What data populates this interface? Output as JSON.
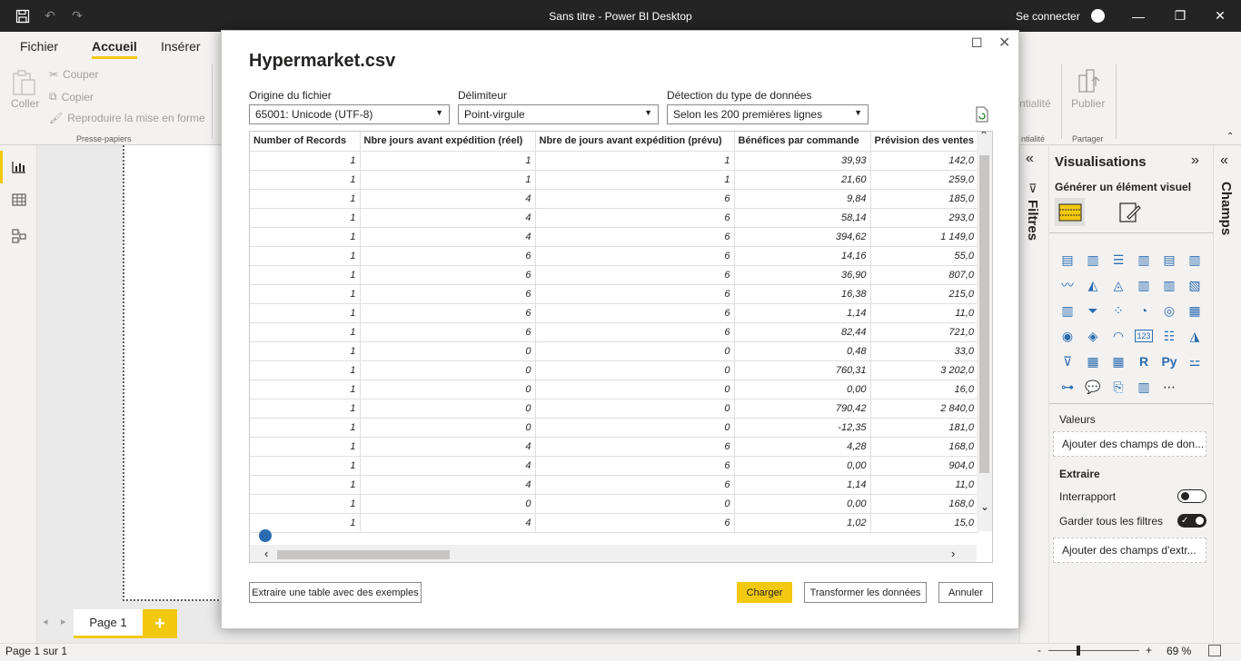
{
  "app": {
    "title": "Sans titre - Power BI Desktop",
    "signin": "Se connecter"
  },
  "ribbon": {
    "tabs": [
      "Fichier",
      "Accueil",
      "Insérer"
    ],
    "clipboard": {
      "paste": "Coller",
      "cut": "Couper",
      "copy": "Copier",
      "format_painter": "Reproduire la mise en forme",
      "group": "Presse-papiers"
    },
    "sensitivity": "ntialité",
    "sensitivity_group": "ntialité",
    "publish": "Publier",
    "share_group": "Partager"
  },
  "page_tab": "Page 1",
  "status": {
    "page_info": "Page 1 sur 1",
    "zoom": "69 %",
    "minus": "-",
    "plus": "+"
  },
  "filters_label": "Filtres",
  "visualizations": {
    "title": "Visualisations",
    "subtitle": "Générer un élément visuel",
    "values_label": "Valeurs",
    "values_placeholder": "Ajouter des champs de don...",
    "drillthrough_label": "Extraire",
    "cross_report": "Interrapport",
    "keep_filters": "Garder tous les filtres",
    "drill_placeholder": "Ajouter des champs d'extr..."
  },
  "champs_label": "Champs",
  "dialog": {
    "title": "Hypermarket.csv",
    "origin_label": "Origine du fichier",
    "origin_value": "65001: Unicode (UTF-8)",
    "delimiter_label": "Délimiteur",
    "delimiter_value": "Point-virgule",
    "detection_label": "Détection du type de données",
    "detection_value": "Selon les 200 premières lignes",
    "columns": [
      "Number of Records",
      "Nbre jours avant expédition (réel)",
      "Nbre de jours avant expédition (prévu)",
      "Bénéfices par commande",
      "Prévision des ventes"
    ],
    "rows": [
      [
        "1",
        "1",
        "1",
        "39,93",
        "142,0"
      ],
      [
        "1",
        "1",
        "1",
        "21,60",
        "259,0"
      ],
      [
        "1",
        "4",
        "6",
        "9,84",
        "185,0"
      ],
      [
        "1",
        "4",
        "6",
        "58,14",
        "293,0"
      ],
      [
        "1",
        "4",
        "6",
        "394,62",
        "1 149,0"
      ],
      [
        "1",
        "6",
        "6",
        "14,16",
        "55,0"
      ],
      [
        "1",
        "6",
        "6",
        "36,90",
        "807,0"
      ],
      [
        "1",
        "6",
        "6",
        "16,38",
        "215,0"
      ],
      [
        "1",
        "6",
        "6",
        "1,14",
        "11,0"
      ],
      [
        "1",
        "6",
        "6",
        "82,44",
        "721,0"
      ],
      [
        "1",
        "0",
        "0",
        "0,48",
        "33,0"
      ],
      [
        "1",
        "0",
        "0",
        "760,31",
        "3 202,0"
      ],
      [
        "1",
        "0",
        "0",
        "0,00",
        "16,0"
      ],
      [
        "1",
        "0",
        "0",
        "790,42",
        "2 840,0"
      ],
      [
        "1",
        "0",
        "0",
        "-12,35",
        "181,0"
      ],
      [
        "1",
        "4",
        "6",
        "4,28",
        "168,0"
      ],
      [
        "1",
        "4",
        "6",
        "0,00",
        "904,0"
      ],
      [
        "1",
        "4",
        "6",
        "1,14",
        "11,0"
      ],
      [
        "1",
        "0",
        "0",
        "0,00",
        "168,0"
      ],
      [
        "1",
        "4",
        "6",
        "1,02",
        "15,0"
      ]
    ],
    "extract_button": "Extraire une table avec des exemples",
    "load_button": "Charger",
    "transform_button": "Transformer les données",
    "cancel_button": "Annuler"
  },
  "colors": {
    "accent": "#f2c811",
    "titlebar": "#242424"
  }
}
